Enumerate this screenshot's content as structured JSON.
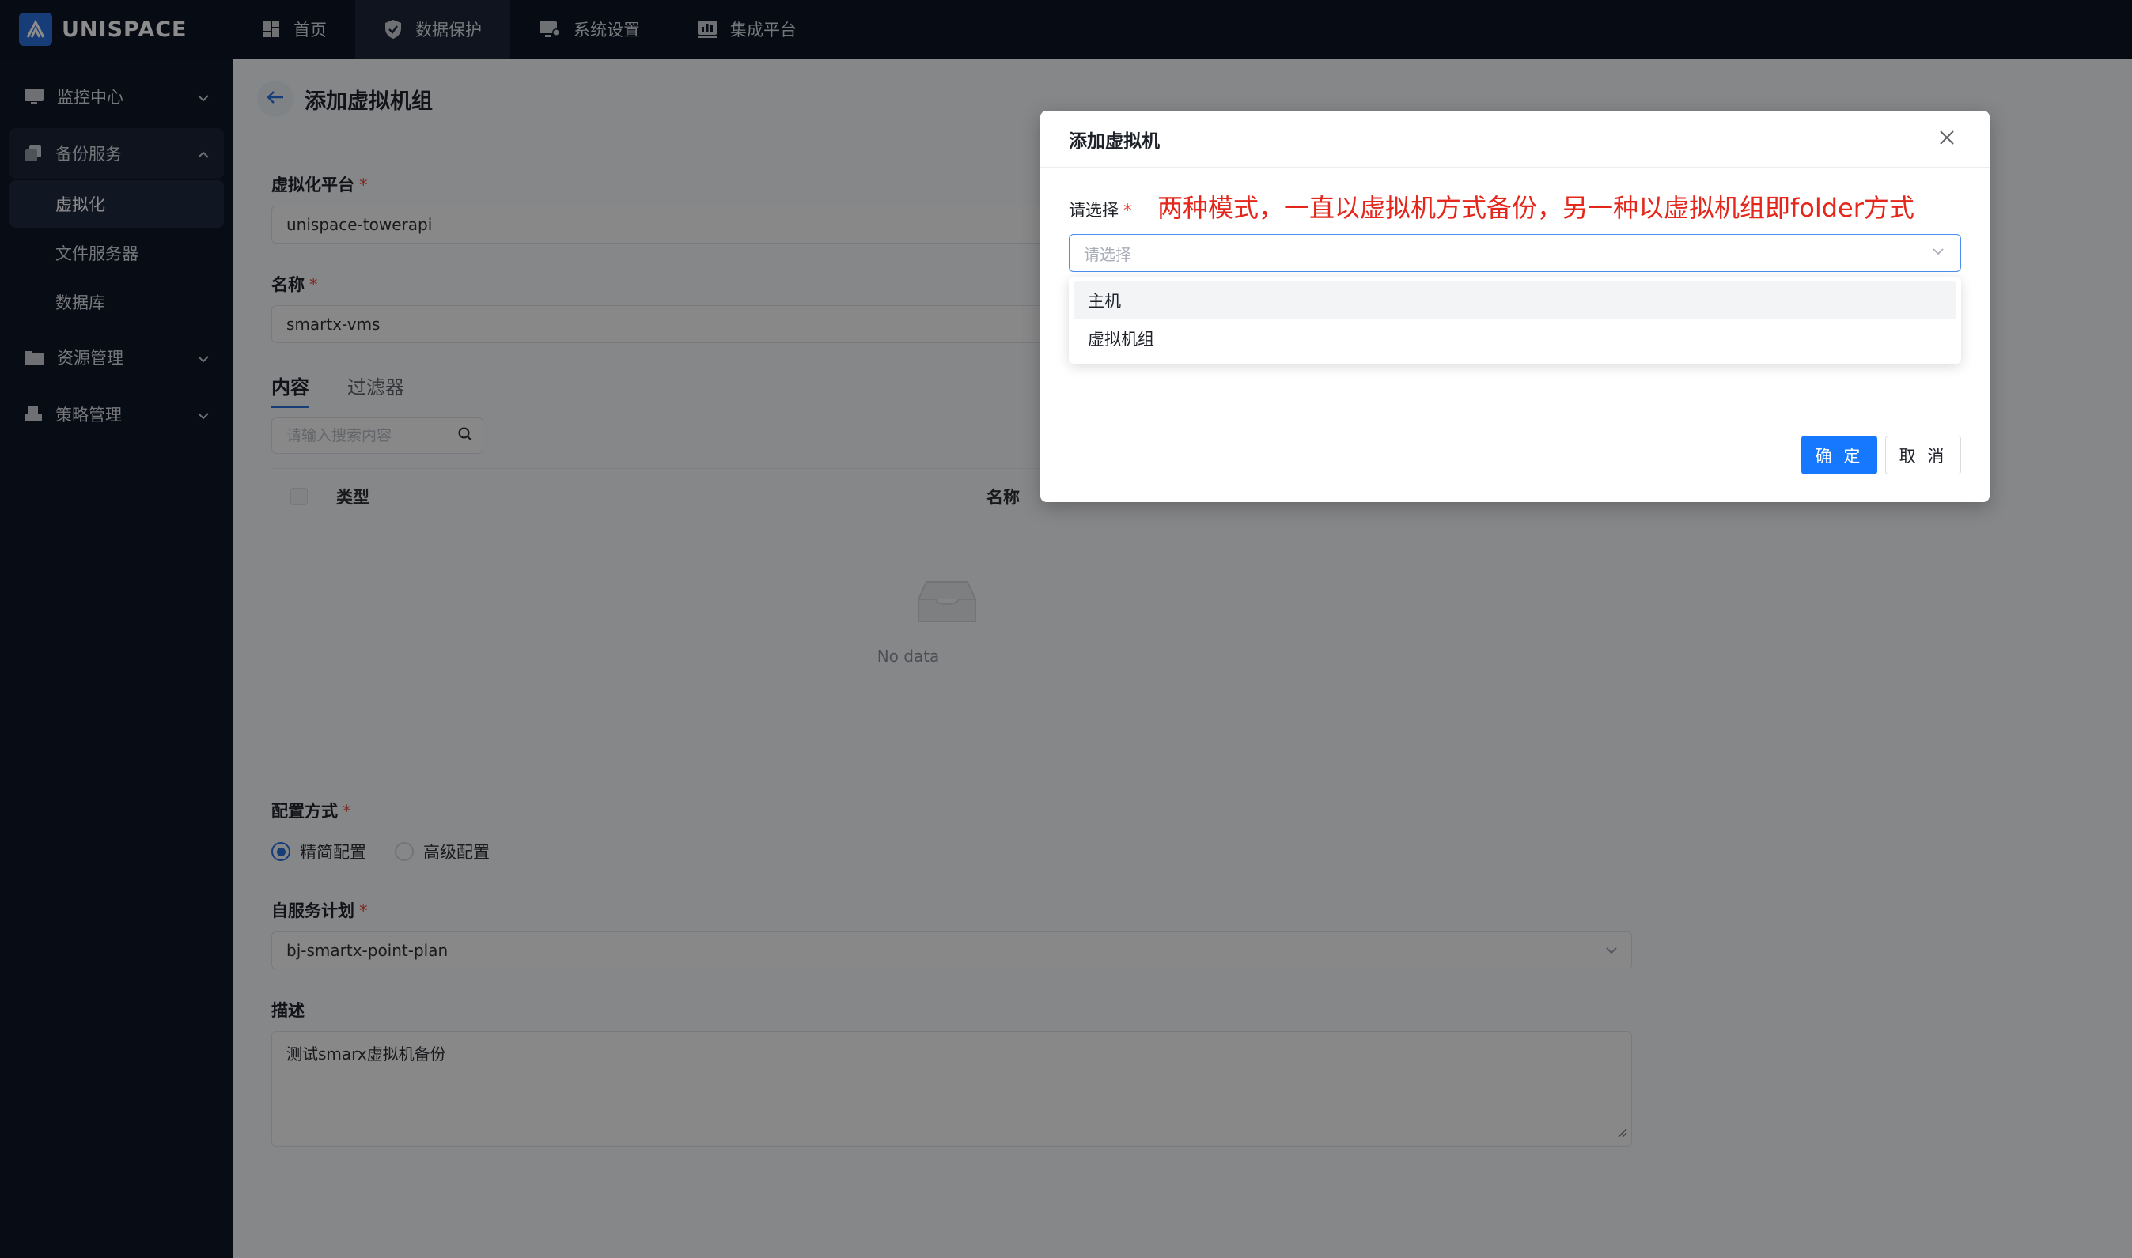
{
  "app": {
    "logo_text": "UNISPACE"
  },
  "topnav": [
    {
      "label": "首页",
      "icon": "dashboard-icon"
    },
    {
      "label": "数据保护",
      "icon": "shield-icon",
      "active": true
    },
    {
      "label": "系统设置",
      "icon": "settings-monitor-icon"
    },
    {
      "label": "集成平台",
      "icon": "chart-board-icon"
    }
  ],
  "sidebar": {
    "groups": [
      {
        "label": "监控中心",
        "icon": "monitor-icon",
        "expanded": false
      },
      {
        "label": "备份服务",
        "icon": "copy-icon",
        "expanded": true,
        "items": [
          {
            "label": "虚拟化",
            "active": true
          },
          {
            "label": "文件服务器"
          },
          {
            "label": "数据库"
          }
        ]
      },
      {
        "label": "资源管理",
        "icon": "folder-icon",
        "expanded": false
      },
      {
        "label": "策略管理",
        "icon": "printer-icon",
        "expanded": false
      }
    ]
  },
  "page": {
    "title": "添加虚拟机组",
    "platform": {
      "label": "虚拟化平台",
      "value": "unispace-towerapi"
    },
    "name": {
      "label": "名称",
      "value": "smartx-vms"
    },
    "tabs": [
      "内容",
      "过滤器"
    ],
    "search": {
      "placeholder": "请输入搜索内容"
    },
    "table": {
      "columns": [
        "类型",
        "名称"
      ],
      "empty_text": "No data"
    },
    "config": {
      "label": "配置方式",
      "options": [
        "精简配置",
        "高级配置"
      ],
      "selected": "精简配置"
    },
    "plan": {
      "label": "自服务计划",
      "value": "bj-smartx-point-plan"
    },
    "description": {
      "label": "描述",
      "value": "测试smarx虚拟机备份"
    }
  },
  "dialog": {
    "title": "添加虚拟机",
    "field_label": "请选择",
    "annotation": "两种模式，一直以虚拟机方式备份，另一种以虚拟机组即folder方式",
    "select_placeholder": "请选择",
    "options": [
      "主机",
      "虚拟机组"
    ],
    "ok_label": "确 定",
    "cancel_label": "取 消"
  },
  "colors": {
    "primary": "#1677ff",
    "annotation": "#e4261b",
    "nav_bg": "#0e1525",
    "required": "#e84a3b"
  }
}
